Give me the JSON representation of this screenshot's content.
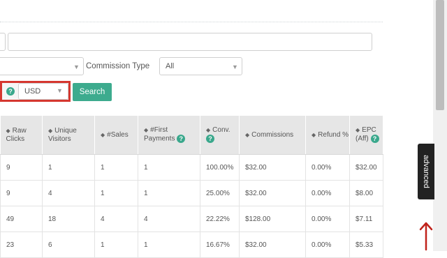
{
  "filters": {
    "commission_type_label": "Commission Type",
    "commission_type_value": "All",
    "currency_value": "USD",
    "search_label": "Search",
    "help_glyph": "?"
  },
  "table": {
    "headers": [
      {
        "label": "Raw Clicks",
        "help": false
      },
      {
        "label": "Unique Visitors",
        "help": false
      },
      {
        "label": "#Sales",
        "help": false
      },
      {
        "label": "#First Payments",
        "help": true
      },
      {
        "label": "Conv.",
        "help": true
      },
      {
        "label": "Commissions",
        "help": false
      },
      {
        "label": "Refund %",
        "help": false
      },
      {
        "label": "EPC (Aff)",
        "help": true
      }
    ],
    "rows": [
      [
        "9",
        "1",
        "1",
        "1",
        "100.00%",
        "$32.00",
        "0.00%",
        "$32.00"
      ],
      [
        "9",
        "4",
        "1",
        "1",
        "25.00%",
        "$32.00",
        "0.00%",
        "$8.00"
      ],
      [
        "49",
        "18",
        "4",
        "4",
        "22.22%",
        "$128.00",
        "0.00%",
        "$7.11"
      ],
      [
        "23",
        "6",
        "1",
        "1",
        "16.67%",
        "$32.00",
        "0.00%",
        "$5.33"
      ]
    ]
  },
  "sidebar": {
    "advanced_label": "advanced"
  },
  "colors": {
    "accent": "#3dab8e",
    "highlight_border": "#d5372f",
    "header_bg": "#e6e6e6"
  }
}
